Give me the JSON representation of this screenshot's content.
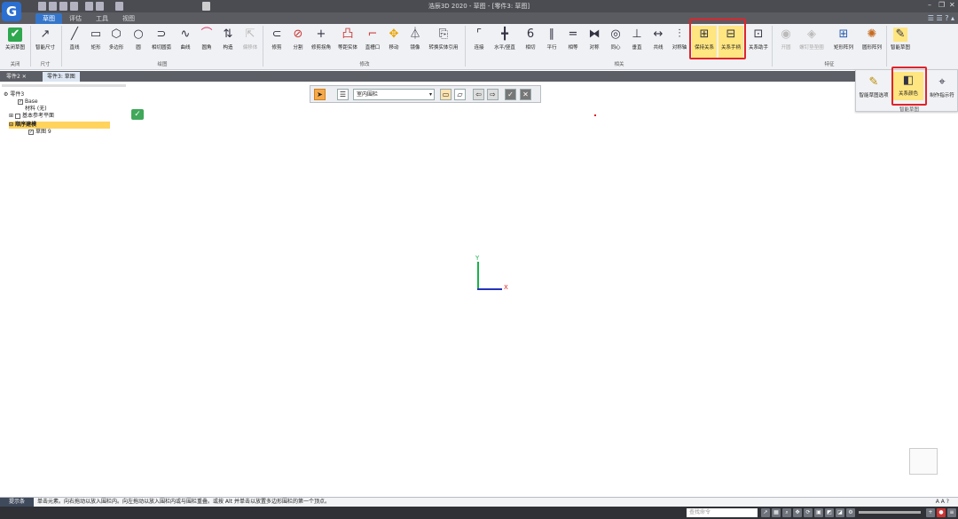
{
  "window": {
    "title": "浩辰3D 2020 - 草图 - [零件3: 草图]"
  },
  "ribbon_tabs": [
    {
      "label": "草图"
    },
    {
      "label": "评估"
    },
    {
      "label": "工具"
    },
    {
      "label": "视图"
    }
  ],
  "tools": [
    {
      "label": "关闭草图",
      "icon": "✔",
      "id": "close-sketch"
    },
    {
      "label": "智能尺寸",
      "icon": "↗",
      "id": "smart-dim"
    },
    {
      "label": "直线",
      "icon": "╱",
      "id": "line"
    },
    {
      "label": "矩形",
      "icon": "▭",
      "id": "rect"
    },
    {
      "label": "多边形",
      "icon": "⬡",
      "id": "polygon"
    },
    {
      "label": "圆",
      "icon": "○",
      "id": "circle"
    },
    {
      "label": "相切圆弧",
      "icon": "⊃",
      "id": "tangent-arc"
    },
    {
      "label": "曲线",
      "icon": "∿",
      "id": "curve"
    },
    {
      "label": "圆角",
      "icon": "⌒",
      "id": "fillet"
    },
    {
      "label": "构造",
      "icon": "⇅",
      "id": "construct"
    },
    {
      "label": "偏移体",
      "icon": "⇱",
      "id": "offset-body"
    },
    {
      "label": "修剪",
      "icon": "⊂",
      "id": "trim"
    },
    {
      "label": "分割",
      "icon": "⊘",
      "id": "split"
    },
    {
      "label": "修剪拐角",
      "icon": "+",
      "id": "trim-corner"
    },
    {
      "label": "等距实体",
      "icon": "凸",
      "id": "offset"
    },
    {
      "label": "直槽口",
      "icon": "⌐",
      "id": "slot"
    },
    {
      "label": "移动",
      "icon": "✥",
      "id": "move"
    },
    {
      "label": "镜像",
      "icon": "⏃",
      "id": "mirror"
    },
    {
      "label": "转换实体引用",
      "icon": "⎘",
      "id": "convert"
    },
    {
      "label": "连接",
      "icon": "⌜",
      "id": "connect"
    },
    {
      "label": "水平/竖直",
      "icon": "╋",
      "id": "hv"
    },
    {
      "label": "相切",
      "icon": "6",
      "id": "tangent"
    },
    {
      "label": "平行",
      "icon": "∥",
      "id": "parallel"
    },
    {
      "label": "相等",
      "icon": "=",
      "id": "equal"
    },
    {
      "label": "对称",
      "icon": "⧓",
      "id": "symmetric"
    },
    {
      "label": "同心",
      "icon": "◎",
      "id": "concentric"
    },
    {
      "label": "垂直",
      "icon": "⊥",
      "id": "perpendicular"
    },
    {
      "label": "共线",
      "icon": "↔",
      "id": "collinear"
    },
    {
      "label": "对称轴",
      "icon": "⫶",
      "id": "sym-axis"
    },
    {
      "label": "保持关系",
      "icon": "⊞",
      "id": "keep-rel"
    },
    {
      "label": "关系手柄",
      "icon": "⊟",
      "id": "rel-handle"
    },
    {
      "label": "关系助手",
      "icon": "⊡",
      "id": "rel-assist"
    },
    {
      "label": "开圆",
      "icon": "◉",
      "id": "open-circle"
    },
    {
      "label": "螺钉垫垫圈",
      "icon": "◈",
      "id": "washer"
    },
    {
      "label": "矩形阵列",
      "icon": "⊞",
      "id": "rect-pattern"
    },
    {
      "label": "圆形阵列",
      "icon": "✺",
      "id": "circ-pattern"
    },
    {
      "label": "智能草图",
      "icon": "✎",
      "id": "smart-sketch"
    }
  ],
  "groups": [
    {
      "label": "关闭"
    },
    {
      "label": "尺寸"
    },
    {
      "label": "绘图"
    },
    {
      "label": "修改"
    },
    {
      "label": "相关"
    },
    {
      "label": "特征"
    }
  ],
  "popup": {
    "items": [
      {
        "label": "智能草图选项"
      },
      {
        "label": "关系颜色"
      },
      {
        "label": "制作指示符"
      }
    ],
    "footer": "智能草图"
  },
  "doc_tabs": [
    {
      "label": "零件2"
    },
    {
      "label": "零件3: 草图"
    }
  ],
  "tree": {
    "root": "零件3",
    "base": "Base",
    "material": "材料 (无)",
    "ref_planes": "基本参考平面",
    "ordered": "顺序建模",
    "sketch": "草图 9"
  },
  "select_bar": {
    "mode": "室内围栏"
  },
  "axes": {
    "x": "X",
    "y": "Y"
  },
  "status": {
    "hint_label": "提示条",
    "text": "单击元素。向右拖动以放入围栏内。向左拖动以放入围栏内或与围栏重叠。或按 Alt 并单击以放置多边形围栏的第一个顶点。"
  },
  "command_placeholder": "查找命令"
}
